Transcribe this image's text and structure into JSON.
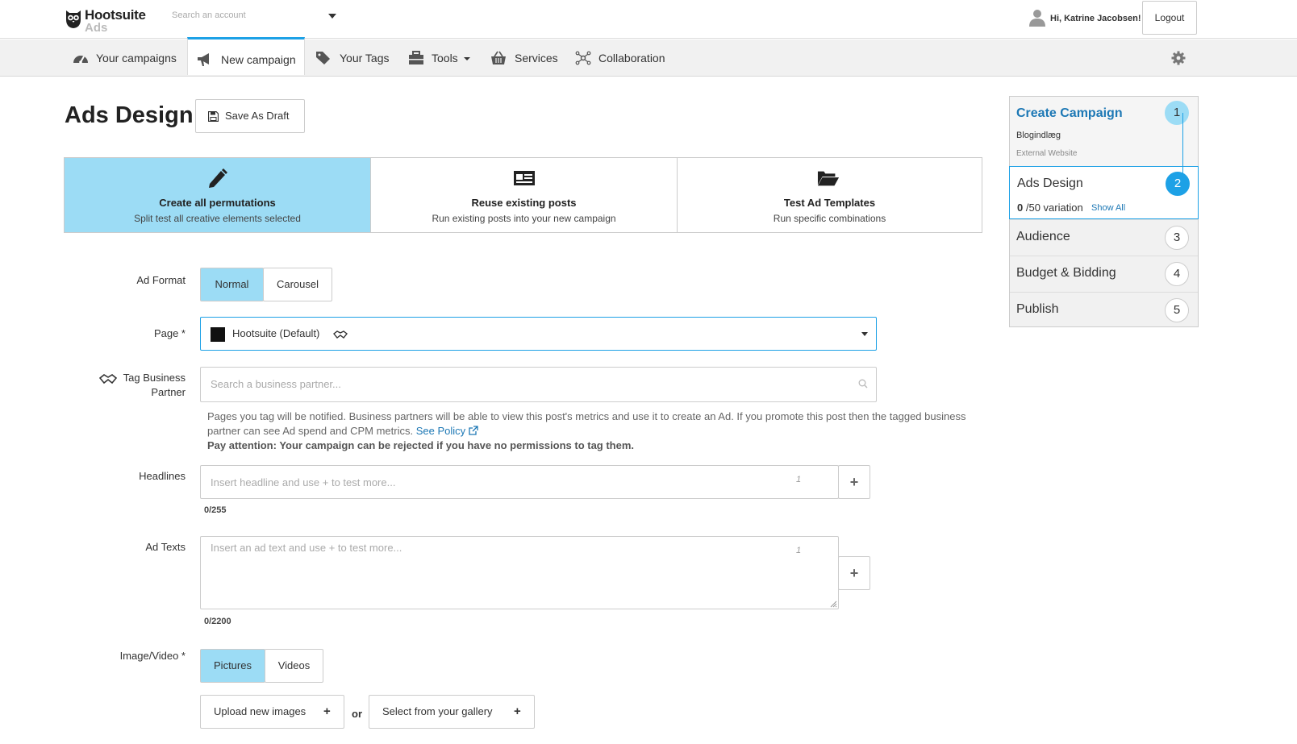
{
  "header": {
    "brand": "Hootsuite",
    "brand_sub": "Ads",
    "account_search_placeholder": "Search an account",
    "greeting": "Hi, Katrine Jacobsen!",
    "logout_label": "Logout"
  },
  "nav": {
    "items": [
      {
        "label": "Your campaigns",
        "icon": "dashboard-icon"
      },
      {
        "label": "New campaign",
        "icon": "megaphone-icon",
        "active": true
      },
      {
        "label": "Your Tags",
        "icon": "tags-icon"
      },
      {
        "label": "Tools",
        "icon": "toolbox-icon",
        "dropdown": true
      },
      {
        "label": "Services",
        "icon": "basket-icon"
      },
      {
        "label": "Collaboration",
        "icon": "network-icon"
      }
    ],
    "settings_icon": "gear-icon"
  },
  "page": {
    "title": "Ads Design",
    "save_draft_label": "Save As Draft"
  },
  "modes": [
    {
      "title": "Create all permutations",
      "subtitle": "Split test all creative elements selected",
      "icon": "pencil-icon",
      "selected": true
    },
    {
      "title": "Reuse existing posts",
      "subtitle": "Run existing posts into your new campaign",
      "icon": "post-card-icon"
    },
    {
      "title": "Test Ad Templates",
      "subtitle": "Run specific combinations",
      "icon": "folder-open-icon"
    }
  ],
  "form": {
    "ad_format": {
      "label": "Ad Format",
      "options": [
        "Normal",
        "Carousel"
      ],
      "selected": "Normal"
    },
    "page": {
      "label": "Page *",
      "value": "Hootsuite (Default)"
    },
    "business_partner": {
      "label_line1": "Tag Business",
      "label_line2": "Partner",
      "placeholder": "Search a business partner..."
    },
    "help": {
      "text": "Pages you tag will be notified. Business partners will be able to view this post's metrics and use it to create an Ad. If you promote this post then the tagged business partner can see Ad spend and CPM metrics.",
      "link": "See Policy",
      "warning": "Pay attention: Your campaign can be rejected if you have no permissions to tag them."
    },
    "headlines": {
      "label": "Headlines",
      "placeholder": "Insert headline and use + to test more...",
      "index": "1",
      "count": "0/255"
    },
    "ad_texts": {
      "label": "Ad Texts",
      "placeholder": "Insert an ad text and use + to test more...",
      "index": "1",
      "count": "0/2200"
    },
    "media": {
      "label": "Image/Video *",
      "options": [
        "Pictures",
        "Videos"
      ],
      "selected": "Pictures"
    },
    "upload_label": "Upload new images",
    "or_label": "or",
    "gallery_label": "Select from your gallery"
  },
  "steps": [
    {
      "num": "1",
      "name": "Create Campaign",
      "detail1": "Blogindlæg",
      "detail2": "External Website"
    },
    {
      "num": "2",
      "name": "Ads Design",
      "variation_count": "0",
      "variation_text": "/50 variation",
      "show_all": "Show All"
    },
    {
      "num": "3",
      "name": "Audience"
    },
    {
      "num": "4",
      "name": "Budget & Bidding"
    },
    {
      "num": "5",
      "name": "Publish"
    }
  ],
  "colors": {
    "accent": "#1da1e6",
    "selected_bg": "#9cdcf5",
    "link": "#1d78b5"
  }
}
